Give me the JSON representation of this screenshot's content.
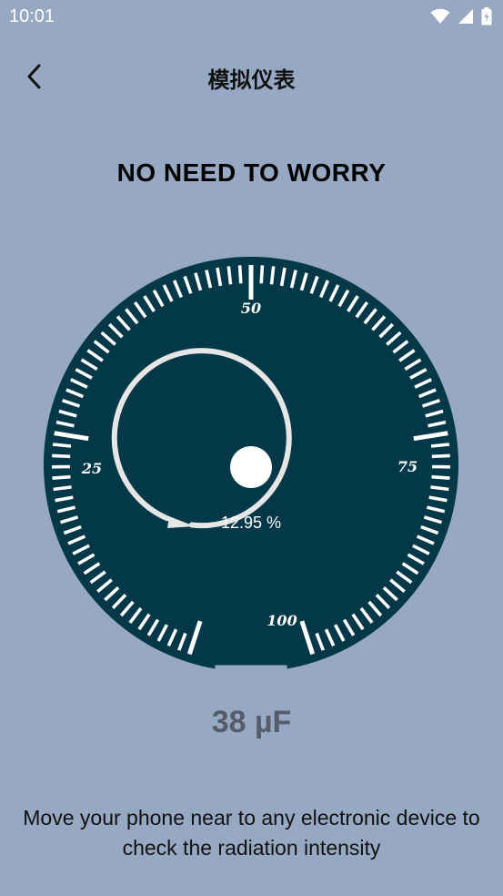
{
  "status_bar": {
    "time": "10:01",
    "icons": [
      "wifi-icon",
      "cellular-signal-icon",
      "battery-charging-icon"
    ]
  },
  "header": {
    "title": "模拟仪表",
    "back_icon": "back-arrow-icon"
  },
  "status_heading": "NO NEED TO WORRY",
  "gauge": {
    "scale_labels": [
      "25",
      "50",
      "75",
      "100"
    ],
    "percent_text": "12.95 %",
    "colors": {
      "dial": "#023847",
      "ticks": "#ffffff",
      "ring": "#e6e6e6"
    }
  },
  "reading": "38 µF",
  "hint": "Move your phone near to any electronic device to check the radiation intensity",
  "colors": {
    "background": "#97a8c3",
    "reading_text": "#555d6a"
  }
}
